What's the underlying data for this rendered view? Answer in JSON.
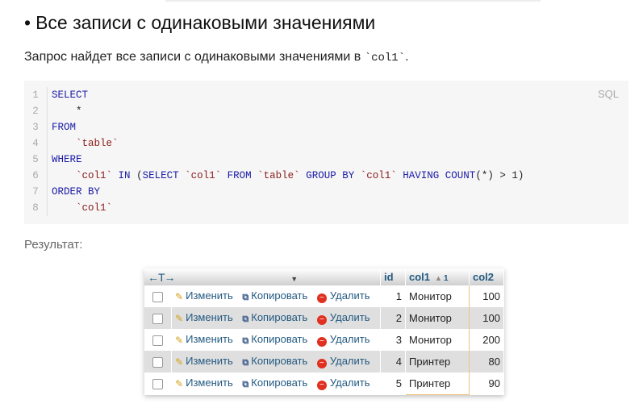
{
  "heading": {
    "bullet": "•",
    "text": "Все записи с одинаковыми значениями"
  },
  "description": {
    "text": "Запрос найдет все записи с одинаковыми значениями в ",
    "code": "`col1`",
    "end": "."
  },
  "code_block": {
    "language": "SQL",
    "line_numbers": [
      "1",
      "2",
      "3",
      "4",
      "5",
      "6",
      "7",
      "8"
    ]
  },
  "result_label": "Результат:",
  "result_table": {
    "header_arrows": "←T→",
    "sort_toggle": "▼",
    "columns": {
      "id": "id",
      "col1": "col1",
      "col1_sort_icon": "▲",
      "col1_sort_index": "1",
      "col2": "col2"
    },
    "actions": {
      "edit": "Изменить",
      "copy": "Копировать",
      "delete": "Удалить"
    },
    "rows": [
      {
        "id": "1",
        "col1": "Монитор",
        "col2": "100"
      },
      {
        "id": "2",
        "col1": "Монитор",
        "col2": "100"
      },
      {
        "id": "3",
        "col1": "Монитор",
        "col2": "200"
      },
      {
        "id": "4",
        "col1": "Принтер",
        "col2": "80"
      },
      {
        "id": "5",
        "col1": "Принтер",
        "col2": "90"
      }
    ]
  }
}
